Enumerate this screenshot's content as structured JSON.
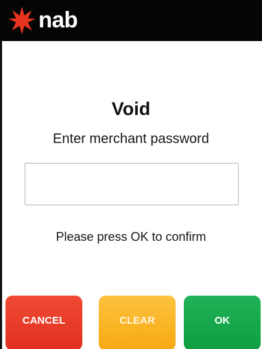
{
  "header": {
    "brand": "nab",
    "logo_icon": "star-icon",
    "star_color": "#e8331f",
    "background": "#050505"
  },
  "main": {
    "title": "Void",
    "prompt": "Enter merchant password",
    "password_value": "",
    "hint": "Please press OK to confirm"
  },
  "buttons": {
    "cancel": {
      "label": "CANCEL",
      "color": "#e63a25"
    },
    "clear": {
      "label": "CLEAR",
      "color": "#f9b324"
    },
    "ok": {
      "label": "OK",
      "color": "#15a84a"
    }
  }
}
